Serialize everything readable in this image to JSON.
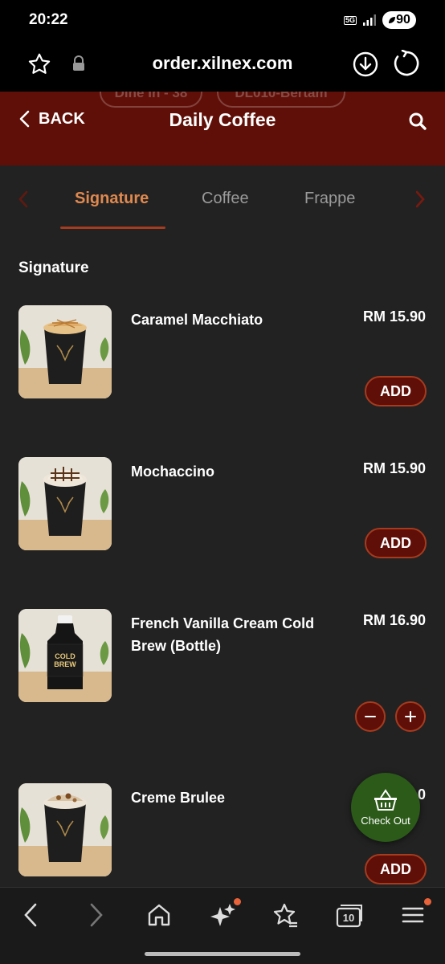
{
  "status_bar": {
    "time": "20:22",
    "network": "5G",
    "battery": "90"
  },
  "browser": {
    "url": "order.xilnex.com"
  },
  "header": {
    "back_label": "BACK",
    "title": "Daily Coffee",
    "ghost_left": "Dine In - 38",
    "ghost_right": "DL010-Bertam"
  },
  "tabs": [
    {
      "label": "Signature",
      "active": true
    },
    {
      "label": "Coffee",
      "active": false
    },
    {
      "label": "Frappe",
      "active": false
    }
  ],
  "section_title": "Signature",
  "products": [
    {
      "name": "Caramel Macchiato",
      "price": "RM 15.90",
      "action": "ADD",
      "thumb": "caramel-macchiato-cup"
    },
    {
      "name": "Mochaccino",
      "price": "RM 15.90",
      "action": "ADD",
      "thumb": "mochaccino-cup"
    },
    {
      "name": "French Vanilla Cream Cold Brew (Bottle)",
      "price": "RM 16.90",
      "action": "stepper",
      "thumb": "cold-brew-bottle",
      "bottle_text": "COLD BREW"
    },
    {
      "name": "Creme Brulee",
      "price": "RM 0",
      "action": "ADD",
      "thumb": "creme-brulee-cup"
    }
  ],
  "checkout": {
    "label": "Check Out"
  },
  "colors": {
    "header": "#5f0f07",
    "accent": "#e0894f",
    "button_border": "#a53b1f",
    "checkout": "#2b5a19",
    "background": "#222222"
  },
  "bottom_nav": [
    "back-icon",
    "forward-icon",
    "home-icon",
    "sparkle-icon",
    "bookmarks-icon",
    "tabs-icon",
    "menu-icon"
  ],
  "tab_count": "10"
}
